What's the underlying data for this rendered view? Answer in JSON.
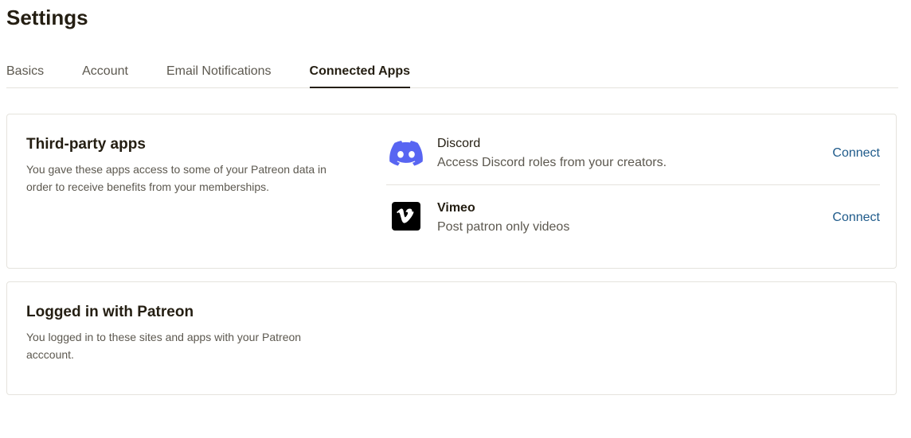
{
  "page": {
    "title": "Settings"
  },
  "tabs": [
    {
      "label": "Basics",
      "active": false
    },
    {
      "label": "Account",
      "active": false
    },
    {
      "label": "Email Notifications",
      "active": false
    },
    {
      "label": "Connected Apps",
      "active": true
    }
  ],
  "third_party": {
    "heading": "Third-party apps",
    "description": "You gave these apps access to some of your Patreon data in order to receive benefits from your memberships.",
    "apps": [
      {
        "name": "Discord",
        "description": "Access Discord roles from your creators.",
        "action": "Connect",
        "icon": "discord-icon",
        "icon_color": "#5865f2"
      },
      {
        "name": "Vimeo",
        "description": "Post patron only videos",
        "action": "Connect",
        "icon": "vimeo-icon",
        "icon_color": "#000000"
      }
    ]
  },
  "patreon_login": {
    "heading": "Logged in with Patreon",
    "description": "You logged in to these sites and apps with your Patreon acccount."
  },
  "colors": {
    "text_primary": "#241e12",
    "text_secondary": "#5c584f",
    "link": "#1e5a8a",
    "border": "#e5e3dd"
  }
}
